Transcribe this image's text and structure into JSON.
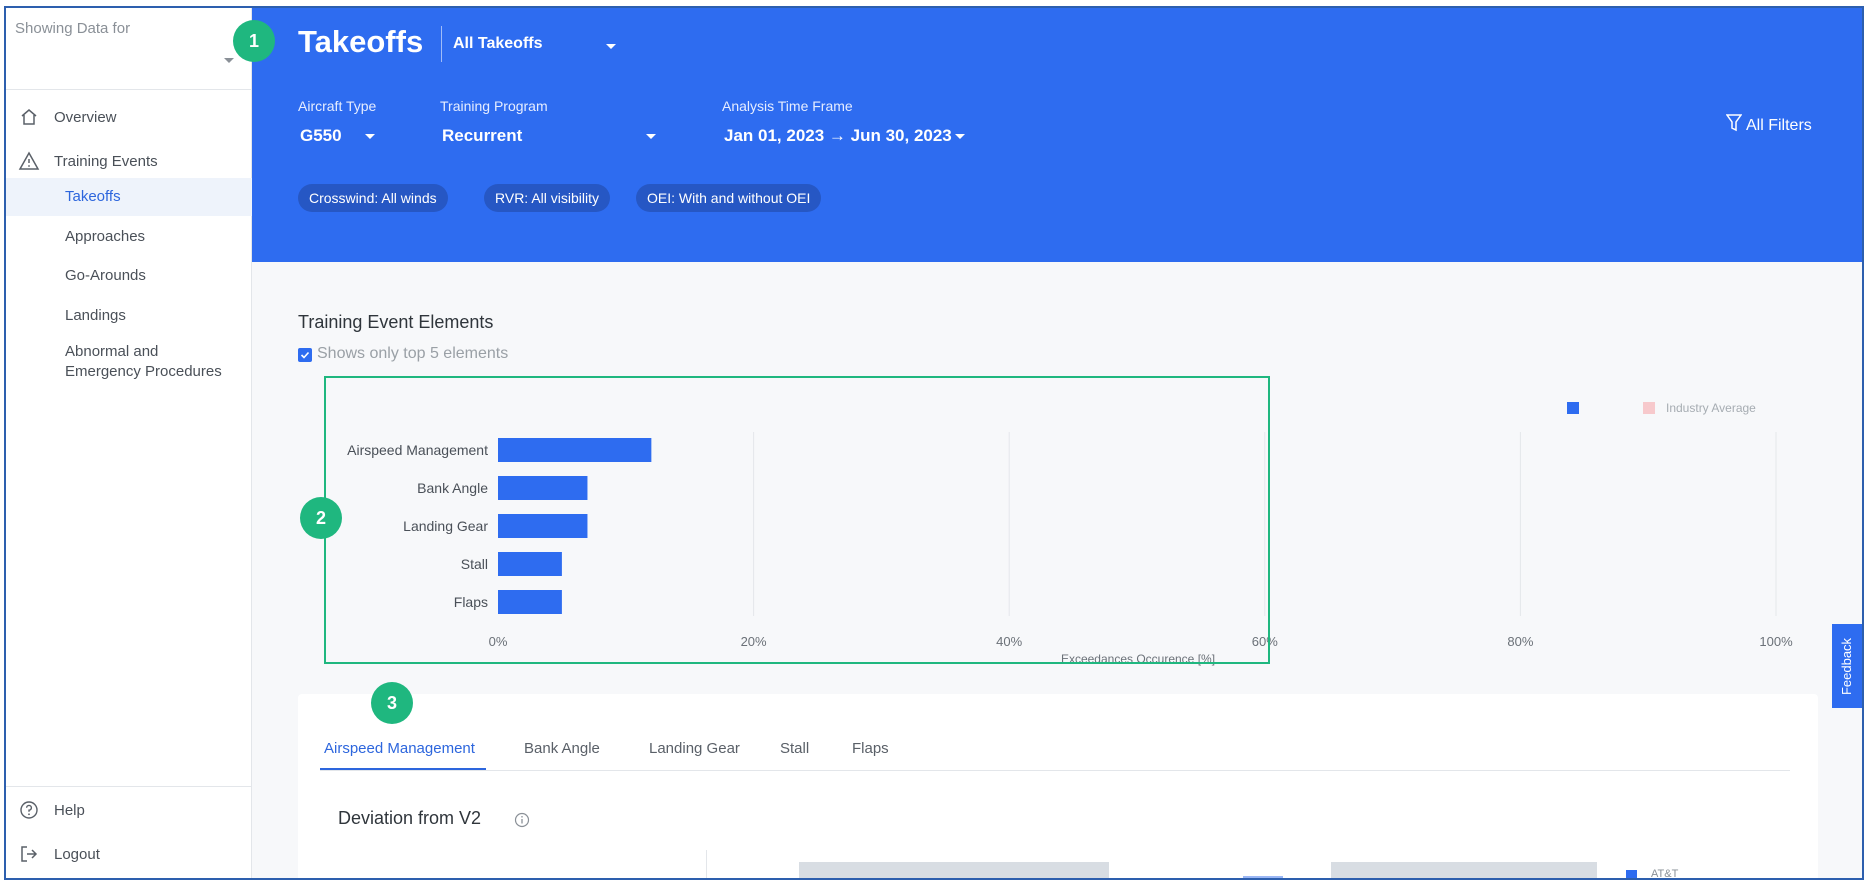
{
  "sidebar": {
    "showing_label": "Showing Data for",
    "nav": [
      {
        "label": "Overview",
        "icon": "home-icon"
      },
      {
        "label": "Training Events",
        "icon": "warning-triangle-icon"
      }
    ],
    "sub_items": [
      "Takeoffs",
      "Approaches",
      "Go-Arounds",
      "Landings"
    ],
    "abnormal_line1": "Abnormal and",
    "abnormal_line2": "Emergency Procedures",
    "help": "Help",
    "logout": "Logout"
  },
  "header": {
    "title": "Takeoffs",
    "takeoff_filter": "All Takeoffs",
    "aircraft_type_label": "Aircraft Type",
    "aircraft_type_value": "G550",
    "program_label": "Training Program",
    "program_value": "Recurrent",
    "timeframe_label": "Analysis Time Frame",
    "timeframe_value": "Jan 01, 2023 → Jun 30, 2023",
    "all_filters": "All Filters",
    "chips": [
      "Crosswind: All winds",
      "RVR: All visibility",
      "OEI: With and without OEI"
    ]
  },
  "elements": {
    "title": "Training Event Elements",
    "checkbox_label": "Shows only top 5 elements"
  },
  "chart_data": {
    "type": "bar",
    "orientation": "horizontal",
    "categories": [
      "Airspeed Management",
      "Bank Angle",
      "Landing Gear",
      "Stall",
      "Flaps"
    ],
    "series": [
      {
        "values": [
          12,
          7,
          7,
          5,
          5
        ],
        "color": "#2e6cf0"
      }
    ],
    "legend": [
      "Industry Average"
    ],
    "legend_colors": [
      "#2e6cf0",
      "#f7c9cc"
    ],
    "xlim": [
      0,
      100
    ],
    "xticks": [
      "0%",
      "20%",
      "40%",
      "60%",
      "80%",
      "100%"
    ],
    "xlabel": "Exceedances Occurence [%]",
    "grid": true
  },
  "callouts": [
    "1",
    "2",
    "3"
  ],
  "feedback": "Feedback",
  "tabs": [
    "Airspeed Management",
    "Bank Angle",
    "Landing Gear",
    "Stall",
    "Flaps"
  ],
  "deviation_title": "Deviation from V2",
  "bottom_legend": "AT&T"
}
